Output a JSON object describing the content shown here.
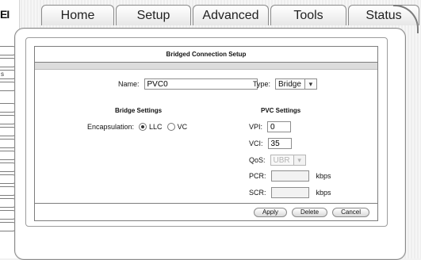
{
  "left_rail": {
    "brand_fragment": "EI",
    "item_label_fragment": "s"
  },
  "nav": {
    "tabs": [
      {
        "label": "Home"
      },
      {
        "label": "Setup"
      },
      {
        "label": "Advanced"
      },
      {
        "label": "Tools"
      },
      {
        "label": "Status"
      }
    ]
  },
  "form": {
    "title": "Bridged Connection Setup",
    "name_label": "Name:",
    "name_value": "PVC0",
    "type_label": "Type:",
    "type_value": "Bridge",
    "bridge_settings_heading": "Bridge Settings",
    "pvc_settings_heading": "PVC Settings",
    "encapsulation_label": "Encapsulation:",
    "encapsulation_options": [
      {
        "label": "LLC",
        "selected": true
      },
      {
        "label": "VC",
        "selected": false
      }
    ],
    "vpi_label": "VPI:",
    "vpi_value": "0",
    "vci_label": "VCI:",
    "vci_value": "35",
    "qos_label": "QoS:",
    "qos_value": "UBR",
    "pcr_label": "PCR:",
    "pcr_value": "",
    "scr_label": "SCR:",
    "scr_value": "",
    "units": "kbps",
    "buttons": {
      "apply": "Apply",
      "delete": "Delete",
      "cancel": "Cancel"
    }
  }
}
